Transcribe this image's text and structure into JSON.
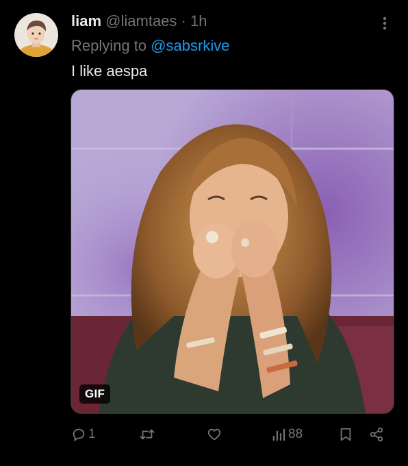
{
  "tweet": {
    "author_name": "liam",
    "handle": "@liamtaes",
    "separator": "·",
    "time": "1h",
    "replying_prefix": "Replying to",
    "replying_handle": "@sabsrkive",
    "text": "I like aespa",
    "gif_badge": "GIF"
  },
  "actions": {
    "reply_count": "1",
    "retweet_count": "",
    "like_count": "",
    "views_count": "88"
  },
  "icons": {
    "more": "more-vertical-icon",
    "reply": "reply-icon",
    "retweet": "retweet-icon",
    "like": "heart-icon",
    "views": "views-bar-chart-icon",
    "bookmark": "bookmark-icon",
    "share": "share-icon"
  },
  "colors": {
    "background": "#000000",
    "text_primary": "#e7e9ea",
    "text_muted": "#71767b",
    "accent": "#1d9bf0"
  }
}
